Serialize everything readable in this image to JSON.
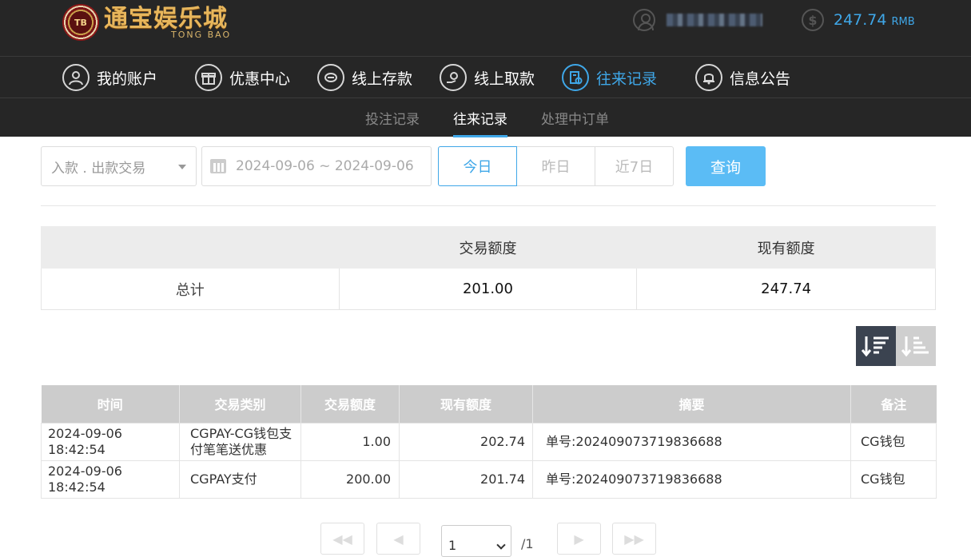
{
  "header": {
    "logo_badge": "TB",
    "logo_main": "通宝娱乐城",
    "logo_sub": "TONG BAO",
    "balance": "247.74",
    "currency": "RMB"
  },
  "nav": {
    "items": [
      {
        "label": "我的账户",
        "icon": "user-circle-icon"
      },
      {
        "label": "优惠中心",
        "icon": "gift-icon"
      },
      {
        "label": "线上存款",
        "icon": "deposit-icon"
      },
      {
        "label": "线上取款",
        "icon": "withdraw-icon"
      },
      {
        "label": "往来记录",
        "icon": "records-icon"
      },
      {
        "label": "信息公告",
        "icon": "bell-icon"
      }
    ],
    "active": "往来记录"
  },
  "subnav": {
    "items": [
      "投注记录",
      "往来记录",
      "处理中订单"
    ],
    "active": "往来记录"
  },
  "filters": {
    "type_select": "入款 . 出款交易",
    "date_range": "2024-09-06 ~ 2024-09-06",
    "quick_ranges": [
      "今日",
      "昨日",
      "近7日"
    ],
    "active_range": "今日",
    "query_label": "查询"
  },
  "summary": {
    "headers": [
      "",
      "交易额度",
      "现有额度"
    ],
    "row_label": "总计",
    "trade_amount": "201.00",
    "current_amount": "247.74"
  },
  "table": {
    "headers": [
      "时间",
      "交易类别",
      "交易额度",
      "现有额度",
      "摘要",
      "备注"
    ],
    "rows": [
      {
        "time": "2024-09-06 18:42:54",
        "type": "CGPAY-CG钱包支付笔笔送优惠",
        "amount": "1.00",
        "balance": "202.74",
        "summary": "单号:202409073719836688",
        "note": "CG钱包"
      },
      {
        "time": "2024-09-06 18:42:54",
        "type": "CGPAY支付",
        "amount": "200.00",
        "balance": "201.74",
        "summary": "单号:202409073719836688",
        "note": "CG钱包"
      }
    ]
  },
  "pagination": {
    "page": "1",
    "total": "/1"
  },
  "colors": {
    "accent": "#3fa7e8",
    "button": "#5bbcf5",
    "header_bg": "#262626"
  }
}
